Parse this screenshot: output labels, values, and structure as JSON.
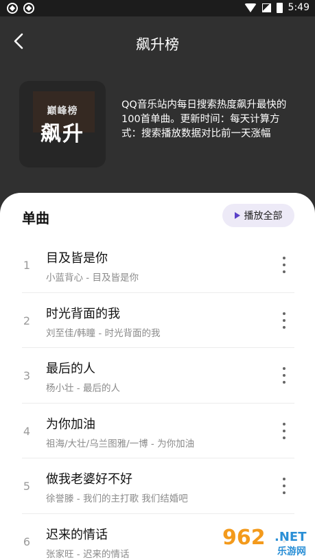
{
  "status_bar": {
    "time": "5:49",
    "left_icons": [
      "sync-icon",
      "sync-icon"
    ],
    "right_icons": [
      "wifi-icon",
      "signal-icon",
      "battery-icon"
    ]
  },
  "header": {
    "title": "飙升榜",
    "back_icon": "chevron-left-icon"
  },
  "playlist": {
    "cover_text_top": "巅峰榜",
    "cover_text_main": "飙升",
    "description": "QQ音乐站内每日搜索热度飙升最快的100首单曲。更新时间：每天计算方式：搜索播放数据对比前一天涨幅"
  },
  "songs_section": {
    "title": "单曲",
    "play_all_label": "播放全部",
    "play_icon": "play-icon",
    "songs": [
      {
        "rank": "1",
        "title": "目及皆是你",
        "meta": "小蓝背心 - 目及皆是你"
      },
      {
        "rank": "2",
        "title": "时光背面的我",
        "meta": "刘至佳/韩瞳 - 时光背面的我"
      },
      {
        "rank": "3",
        "title": "最后的人",
        "meta": "杨小壮 - 最后的人"
      },
      {
        "rank": "4",
        "title": "为你加油",
        "meta": "祖海/大壮/乌兰图雅/一博 - 为你加油"
      },
      {
        "rank": "5",
        "title": "做我老婆好不好",
        "meta": "徐誉滕 - 我们的主打歌 我们结婚吧"
      },
      {
        "rank": "6",
        "title": "迟来的情话",
        "meta": "张家旺 - 迟来的情话"
      }
    ]
  },
  "watermark": {
    "number": "962",
    "suffix": ".NET",
    "site": "乐游网"
  },
  "colors": {
    "background": "#303030",
    "sheet": "#ffffff",
    "accent": "#5a40c8",
    "play_all_bg": "#edeaf7"
  }
}
